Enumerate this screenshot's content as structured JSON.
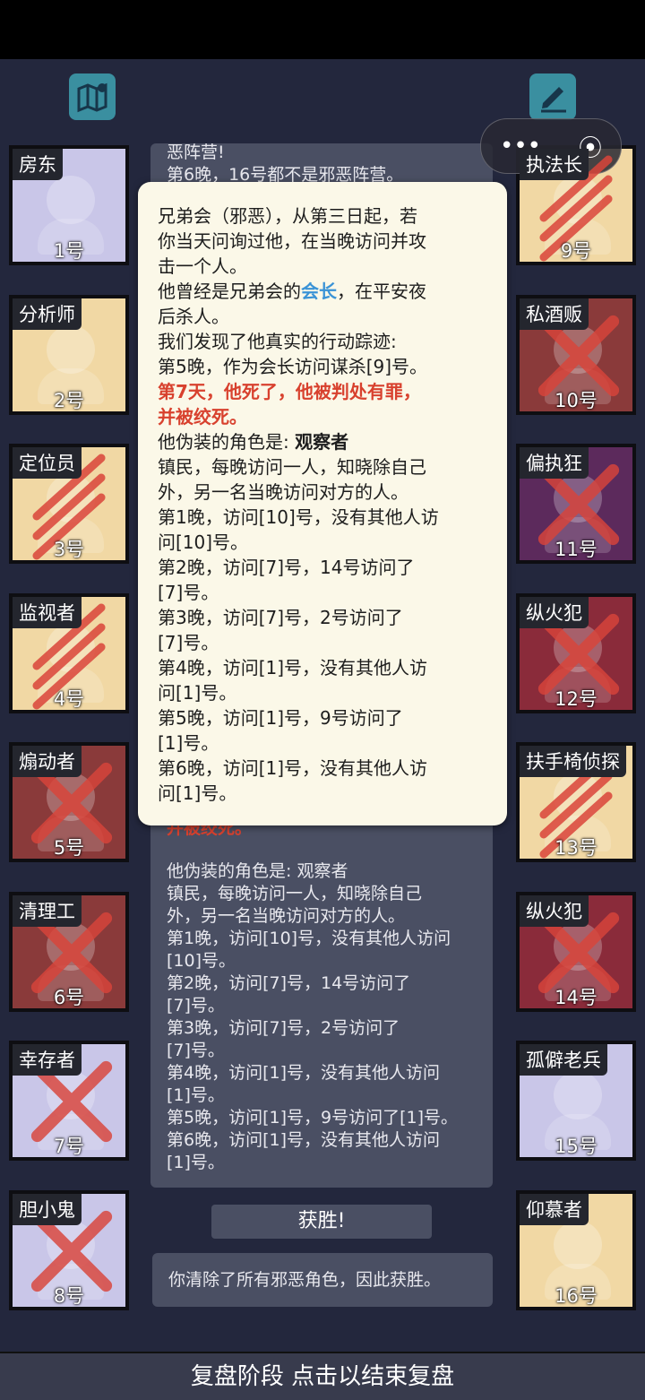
{
  "header": {
    "left_icon": "map-icon",
    "right_icon": "pen-icon"
  },
  "miniprogram": {
    "more": "•••",
    "close": "⦿"
  },
  "left_players": [
    {
      "role": "房东",
      "num": "1号",
      "bg": "#c9c6e8",
      "dead": false,
      "mark": "none"
    },
    {
      "role": "分析师",
      "num": "2号",
      "bg": "#f1d8a4",
      "dead": false,
      "mark": "none"
    },
    {
      "role": "定位员",
      "num": "3号",
      "bg": "#f1d8a4",
      "dead": true,
      "mark": "slash"
    },
    {
      "role": "监视者",
      "num": "4号",
      "bg": "#f1d8a4",
      "dead": true,
      "mark": "slash"
    },
    {
      "role": "煽动者",
      "num": "5号",
      "bg": "#8a3a3a",
      "dead": true,
      "mark": "x"
    },
    {
      "role": "清理工",
      "num": "6号",
      "bg": "#8a3a3a",
      "dead": true,
      "mark": "x"
    },
    {
      "role": "幸存者",
      "num": "7号",
      "bg": "#c9c6e8",
      "dead": true,
      "mark": "x"
    },
    {
      "role": "胆小鬼",
      "num": "8号",
      "bg": "#c9c6e8",
      "dead": true,
      "mark": "x"
    }
  ],
  "right_players": [
    {
      "role": "执法长",
      "num": "9号",
      "bg": "#f1d8a4",
      "dead": true,
      "mark": "slash"
    },
    {
      "role": "私酒贩",
      "num": "10号",
      "bg": "#8a3a3a",
      "dead": true,
      "mark": "x"
    },
    {
      "role": "偏执狂",
      "num": "11号",
      "bg": "#5c2a5c",
      "dead": true,
      "mark": "x"
    },
    {
      "role": "纵火犯",
      "num": "12号",
      "bg": "#8a2b3a",
      "dead": true,
      "mark": "x"
    },
    {
      "role": "扶手椅侦探",
      "num": "13号",
      "bg": "#f1d8a4",
      "dead": true,
      "mark": "slash"
    },
    {
      "role": "纵火犯",
      "num": "14号",
      "bg": "#8a2b3a",
      "dead": true,
      "mark": "x"
    },
    {
      "role": "孤僻老兵",
      "num": "15号",
      "bg": "#c9c6e8",
      "dead": false,
      "mark": "none"
    },
    {
      "role": "仰慕者",
      "num": "16号",
      "bg": "#f1d8a4",
      "dead": false,
      "mark": "none"
    }
  ],
  "log_panel": {
    "top_lines": [
      "恶阵营!",
      "第6晚，16号都不是邪恶阵营。"
    ],
    "partial": "并被绞死。",
    "lines": [
      "他伪装的角色是: 观察者",
      "镇民，每晚访问一人，知晓除自己",
      "外，另一名当晚访问对方的人。",
      "第1晚，访问[10]号，没有其他人访问",
      "[10]号。",
      "第2晚，访问[7]号，14号访问了",
      "[7]号。",
      "第3晚，访问[7]号，2号访问了",
      "[7]号。",
      "第4晚，访问[1]号，没有其他人访问",
      "[1]号。",
      "第5晚，访问[1]号，9号访问了[1]号。",
      "第6晚，访问[1]号，没有其他人访问",
      "[1]号。"
    ]
  },
  "victory_button": "获胜!",
  "result_text": "你清除了所有邪恶角色，因此获胜。",
  "popup": {
    "l1": "兄弟会（邪恶），从第三日起，若",
    "l2": "你当天问询过他，在当晚访问并攻",
    "l3": "击一个人。",
    "l4a": "他曾经是兄弟会的",
    "l4b": "会长",
    "l4c": "，在平安夜",
    "l5": "后杀人。",
    "l6": "我们发现了他真实的行动踪迹:",
    "l7": "第5晚，作为会长访问谋杀[9]号。",
    "l8": "第7天，他死了，他被判处有罪，",
    "l9": "并被绞死。",
    "l10a": "他伪装的角色是: ",
    "l10b": "观察者",
    "l11": "镇民，每晚访问一人，知晓除自己",
    "l12": "外，另一名当晚访问对方的人。",
    "l13": "第1晚，访问[10]号，没有其他人访",
    "l14": "问[10]号。",
    "l15": "第2晚，访问[7]号，14号访问了",
    "l16": "[7]号。",
    "l17": "第3晚，访问[7]号，2号访问了",
    "l18": "[7]号。",
    "l19": "第4晚，访问[1]号，没有其他人访",
    "l20": "问[1]号。",
    "l21": "第5晚，访问[1]号，9号访问了",
    "l22": "[1]号。",
    "l23": "第6晚，访问[1]号，没有其他人访",
    "l24": "问[1]号。"
  },
  "bottom_bar": "复盘阶段 点击以结束复盘"
}
